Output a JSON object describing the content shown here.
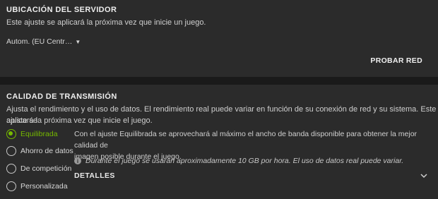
{
  "server": {
    "title": "UBICACIÓN DEL SERVIDOR",
    "description": "Este ajuste se aplicará la próxima vez que inicie un juego.",
    "selected_location": "Autom. (EU Centr…",
    "test_button": "PROBAR RED"
  },
  "streaming": {
    "title": "CALIDAD DE TRANSMISIÓN",
    "description_line1": "Ajusta el rendimiento y el uso de datos. El rendimiento real puede variar en función de su conexión de red y su sistema. Este ajuste se",
    "description_line2": "aplicará la próxima vez que inicie el juego.",
    "options": [
      {
        "label": "Equilibrada",
        "selected": true
      },
      {
        "label": "Ahorro de datos",
        "selected": false
      },
      {
        "label": "De competición",
        "selected": false
      },
      {
        "label": "Personalizada",
        "selected": false
      }
    ],
    "explanation_line1": "Con el ajuste Equilibrada se aprovechará al máximo el ancho de banda disponible para obtener la mejor calidad de",
    "explanation_line2": "imagen posible durante el juego.",
    "info_text": "Durante el juego se usarán aproximadamente 10 GB por hora. El uso de datos real puede variar.",
    "details_label": "DETALLES"
  },
  "colors": {
    "accent": "#76b900",
    "panel": "#2b2b2b",
    "background": "#1a1a1a"
  },
  "icons": {
    "dropdown": "caret-down-icon",
    "info": "info-icon",
    "details": "chevron-down-icon"
  }
}
